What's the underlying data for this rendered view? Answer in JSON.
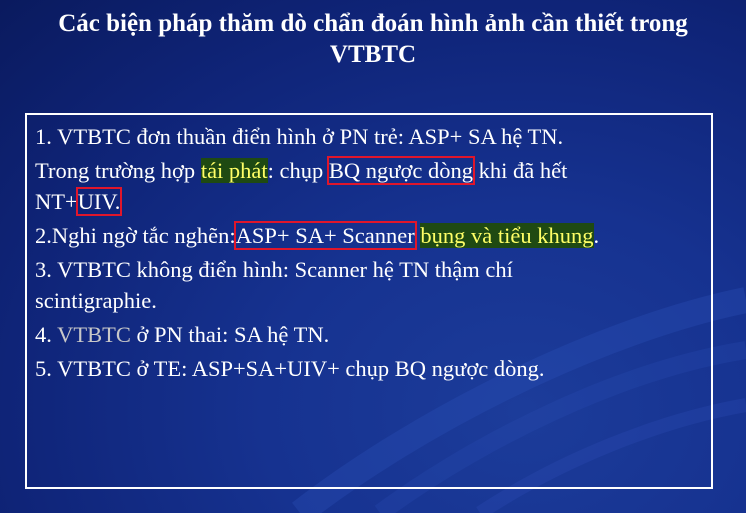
{
  "slide": {
    "title_line1": "Các biện pháp thăm dò chẩn đoán hình ảnh cần thiết trong",
    "title_line2": "VTBTC"
  },
  "content": {
    "item1": "1. VTBTC đơn thuần điển hình ở PN trẻ: ASP+ SA hệ TN.",
    "item1b_pre": "Trong trường hợp ",
    "item1b_hl": "tái phát",
    "item1b_mid": ": chụp ",
    "item1b_box": "BQ ngược dòng",
    "item1b_post": " khi đã hết",
    "item1c_pre": "NT+",
    "item1c_box": "UIV.",
    "item2_pre": "2.Nghi ngờ tắc nghẽn:",
    "item2_box": "ASP+ SA+ Scanner",
    "item2_sp": " ",
    "item2_hl": "bụng và tiểu khung",
    "item2_post": ".",
    "item3a": "3. VTBTC không điển hình: Scanner hệ TN thậm chí",
    "item3b": "scintigraphie.",
    "item4_pre": "4. ",
    "item4_dim": "VTBTC",
    "item4_post": " ở PN thai: SA hệ TN.",
    "item5": "5. VTBTC ở TE: ASP+SA+UIV+ chụp BQ ngược dòng."
  },
  "colors": {
    "background": "#0f2478",
    "text": "#ffffff",
    "highlight_bg": "#1f4a12",
    "highlight_text": "#ffff66",
    "box_border": "#e0162b"
  }
}
